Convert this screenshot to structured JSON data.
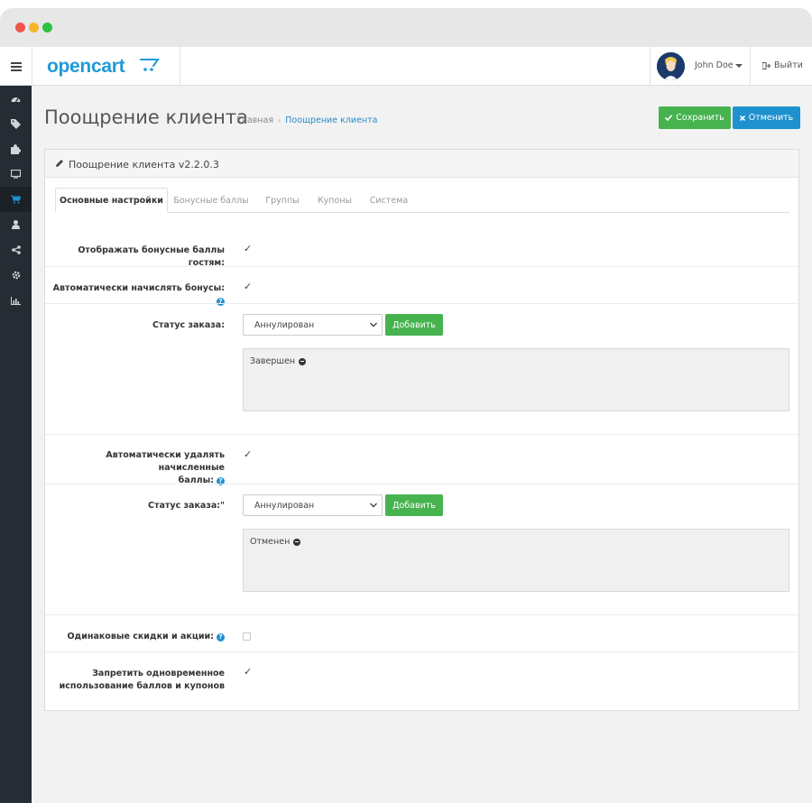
{
  "header": {
    "logo_text": "opencart",
    "user_name": "John Doe",
    "logout_label": "Выйти"
  },
  "sidebar": {
    "items": [
      {
        "icon": "dashboard-icon"
      },
      {
        "icon": "tags-icon"
      },
      {
        "icon": "puzzle-icon"
      },
      {
        "icon": "desktop-icon"
      },
      {
        "icon": "shopping-cart-icon",
        "active": true
      },
      {
        "icon": "user-icon"
      },
      {
        "icon": "share-icon"
      },
      {
        "icon": "gear-icon"
      },
      {
        "icon": "bar-chart-icon"
      }
    ]
  },
  "page": {
    "title": "Поощрение клиента",
    "breadcrumb": [
      "Главная",
      "Поощрение клиента"
    ],
    "save_label": "Сохранить",
    "cancel_label": "Отменить"
  },
  "panel": {
    "title": "Поощрение клиента v2.2.0.3",
    "tabs": [
      "Основные настройки",
      "Бонусные баллы",
      "Группы",
      "Купоны",
      "Система"
    ]
  },
  "form": {
    "show_to_guests_label": "Отображать бонусные баллы гостям:",
    "auto_accrue_label": "Автоматически начислять бонусы:",
    "order_status_1_label": "Статус заказа:",
    "order_status_1_select": "Аннулирован",
    "add_1_label": "Добавить",
    "order_status_1_item": "Завершен",
    "auto_remove_label_line1": "Автоматически удалять начисленные",
    "auto_remove_label_line2": "баллы:",
    "order_status_2_label": "Статус заказа:\"",
    "order_status_2_select": "Аннулирован",
    "add_2_label": "Добавить",
    "order_status_2_item": "Отменен",
    "same_discounts_label": "Одинаковые скидки и акции:",
    "forbid_label_line1": "Запретить одновременное",
    "forbid_label_line2": "использование баллов и купонов"
  },
  "colors": {
    "accent": "#1e91cf",
    "success": "#46b34f",
    "sidebar": "#252c33"
  }
}
